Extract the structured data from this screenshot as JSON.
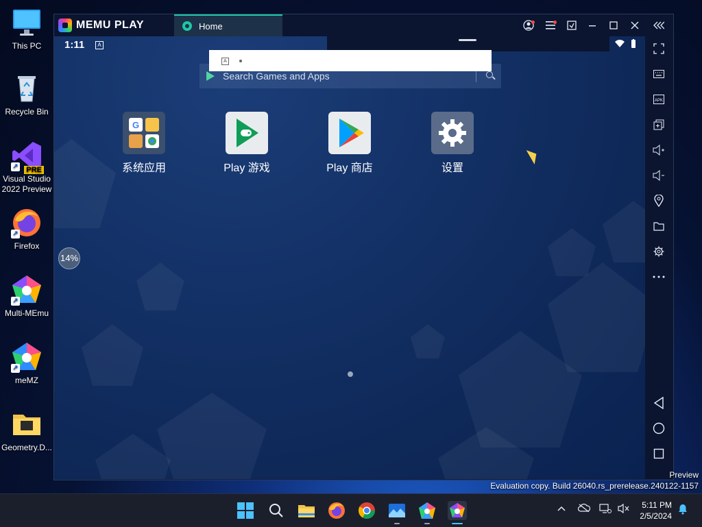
{
  "desktop": {
    "icons": [
      {
        "label": "This PC"
      },
      {
        "label": "Recycle Bin"
      },
      {
        "label": "Visual Studio 2022 Preview",
        "badge": "PRE"
      },
      {
        "label": "Firefox"
      },
      {
        "label": "Multi-MEmu"
      },
      {
        "label": "meMZ"
      },
      {
        "label": "Geometry.D..."
      }
    ]
  },
  "emulator": {
    "brand": "MEMU PLAY",
    "tab_label": "Home",
    "status_time": "1:11",
    "status_badge": "A",
    "popup_badge": "A",
    "search_placeholder": "Search Games and Apps",
    "apps": [
      {
        "label": "系统应用",
        "icon": "system-apps-folder"
      },
      {
        "label": "Play 游戏",
        "icon": "play-games"
      },
      {
        "label": "Play 商店",
        "icon": "play-store"
      },
      {
        "label": "设置",
        "icon": "settings-gear"
      }
    ],
    "progress_label": "14%",
    "progress_value": 14,
    "toolbar": [
      "fullscreen",
      "keyboard",
      "apk",
      "multi-window",
      "volume-up",
      "volume-down",
      "location",
      "folder",
      "settings",
      "more",
      "back",
      "home",
      "recents"
    ]
  },
  "watermark": {
    "line1": "Preview",
    "line2": "Evaluation copy. Build 26040.rs_prerelease.240122-1157"
  },
  "taskbar": {
    "clock_time": "5:11 PM",
    "clock_date": "2/5/2024"
  },
  "colors": {
    "accent": "#1ec8a5",
    "titlebar": "#0b1530",
    "android_bg": "#143268"
  }
}
